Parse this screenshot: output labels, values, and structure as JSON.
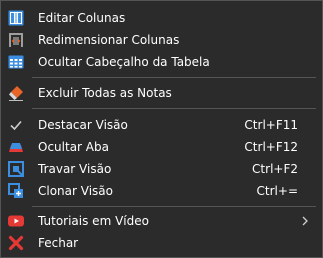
{
  "menu": {
    "items": [
      {
        "label": "Editar Colunas",
        "icon": "edit-columns-icon"
      },
      {
        "label": "Redimensionar Colunas",
        "icon": "resize-columns-icon"
      },
      {
        "label": "Ocultar Cabeçalho da Tabela",
        "icon": "table-header-icon"
      },
      {
        "label": "Excluir Todas as Notas",
        "icon": "eraser-icon"
      },
      {
        "label": "Destacar Visão",
        "shortcut": "Ctrl+F11",
        "icon": "checkmark-icon"
      },
      {
        "label": "Ocultar Aba",
        "shortcut": "Ctrl+F12",
        "icon": "hide-tab-icon"
      },
      {
        "label": "Travar Visão",
        "shortcut": "Ctrl+F2",
        "icon": "lock-view-icon"
      },
      {
        "label": "Clonar Visão",
        "shortcut": "Ctrl+=",
        "icon": "clone-view-icon"
      },
      {
        "label": "Tutoriais em Vídeo",
        "icon": "youtube-icon",
        "submenu_icon": "chevron-right-icon"
      },
      {
        "label": "Fechar",
        "icon": "close-icon"
      }
    ]
  },
  "colors": {
    "background": "#2b2b2b",
    "separator": "#555555",
    "text": "#ffffff",
    "icon_blue": "#3b8ee0",
    "icon_red": "#e53935",
    "icon_orange": "#e8652a"
  }
}
